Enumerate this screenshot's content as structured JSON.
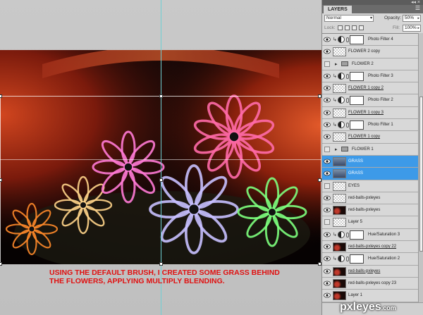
{
  "panel": {
    "tab_label": "LAYERS",
    "menu_icon": "panel-menu-icon",
    "topbar_controls": "◂◂ ×",
    "blend_mode": "Normal",
    "opacity_label": "Opacity:",
    "opacity_value": "50%",
    "lock_label": "Lock:",
    "fill_label": "Fill:",
    "fill_value": "100%"
  },
  "layers": [
    {
      "name": "Photo Filter 4",
      "type": "adjustment",
      "visible": true,
      "clipped": true
    },
    {
      "name": "FLOWER 2 copy",
      "type": "pixel",
      "visible": true,
      "thumb": "checker"
    },
    {
      "name": "FLOWER 2",
      "type": "group",
      "visible": false
    },
    {
      "name": "Photo Filter 3",
      "type": "adjustment",
      "visible": true,
      "clipped": true
    },
    {
      "name": "FLOWER 1 copy 2",
      "type": "pixel",
      "visible": true,
      "thumb": "checker",
      "underline": true
    },
    {
      "name": "Photo Filter 2",
      "type": "adjustment",
      "visible": true,
      "clipped": true
    },
    {
      "name": "FLOWER 1 copy 3",
      "type": "pixel",
      "visible": true,
      "thumb": "checker",
      "underline": true
    },
    {
      "name": "Photo Filter 1",
      "type": "adjustment",
      "visible": true,
      "clipped": true
    },
    {
      "name": "FLOWER 1 copy",
      "type": "pixel",
      "visible": true,
      "thumb": "checker",
      "underline": true
    },
    {
      "name": "FLOWER 1",
      "type": "group",
      "visible": false
    },
    {
      "name": "GRASS",
      "type": "pixel",
      "visible": true,
      "thumb": "grass",
      "selected": true
    },
    {
      "name": "GRASS",
      "type": "pixel",
      "visible": true,
      "thumb": "grass",
      "selected": true
    },
    {
      "name": "EYES",
      "type": "pixel",
      "visible": false,
      "thumb": "checker"
    },
    {
      "name": "red-balls-pxleyes",
      "type": "pixel",
      "visible": true,
      "thumb": "checker"
    },
    {
      "name": "red-balls-pxleyes",
      "type": "pixel",
      "visible": true,
      "thumb": "dark"
    },
    {
      "name": "Layer 5",
      "type": "pixel",
      "visible": false,
      "thumb": "checker"
    },
    {
      "name": "Hue/Saturation 3",
      "type": "adjustment",
      "visible": true,
      "clipped": true
    },
    {
      "name": "red-balls-pxleyes copy 22",
      "type": "pixel",
      "visible": true,
      "thumb": "dark",
      "underline": true
    },
    {
      "name": "Hue/Saturation 2",
      "type": "adjustment",
      "visible": true,
      "clipped": true
    },
    {
      "name": "red-balls-pxleyes",
      "type": "pixel",
      "visible": true,
      "thumb": "dark",
      "underline": true
    },
    {
      "name": "red-balls-pxleyes copy 23",
      "type": "pixel",
      "visible": true,
      "thumb": "dark"
    },
    {
      "name": "Layer 1",
      "type": "pixel",
      "visible": true,
      "thumb": "dark"
    }
  ],
  "caption": {
    "line1": "USING THE DEFAULT BRUSH, I CREATED SOME GRASS BEHIND",
    "line2": "THE FLOWERS, APPLYING MULTIPLY BLENDING."
  },
  "watermark": {
    "main": "pxleyes",
    "suffix": ".com"
  },
  "colors": {
    "caption": "#e01010",
    "selected_layer": "#3d9ae8",
    "guide": "#6fd0d4",
    "panel_bg": "#d6d6d6"
  },
  "flowers": [
    {
      "color": "#ff8a2a"
    },
    {
      "color": "#ffd48a"
    },
    {
      "color": "#ff7ad6"
    },
    {
      "color": "#c8c0ff"
    },
    {
      "color": "#ff6aa8"
    },
    {
      "color": "#7dff7d"
    }
  ]
}
